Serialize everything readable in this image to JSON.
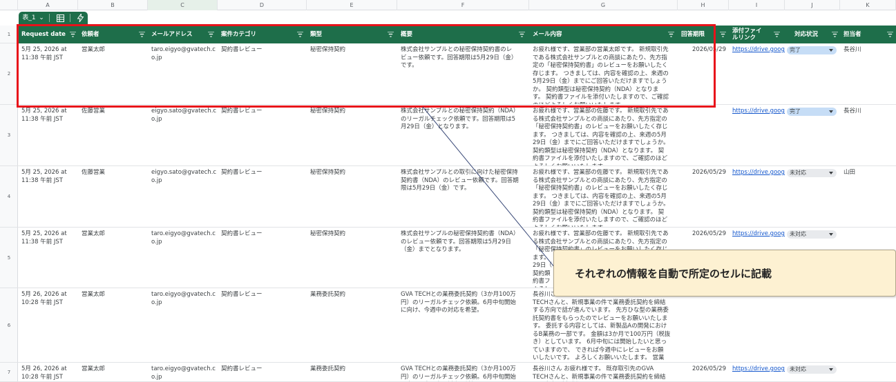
{
  "column_letters": [
    "A",
    "B",
    "C",
    "D",
    "E",
    "F",
    "G",
    "H",
    "I",
    "J",
    "K"
  ],
  "row_numbers": [
    "1",
    "2",
    "3",
    "4",
    "5",
    "6",
    "7"
  ],
  "table_chip": {
    "name": "表_1",
    "chevron": "⌄"
  },
  "colors": {
    "header_bg": "#1e6e4a",
    "highlight": "#e8121a",
    "status_done": "#c6ddf6",
    "status_todo": "#e8eaed",
    "callout_bg": "#fdf1d2",
    "link": "#1155cc"
  },
  "headers": [
    "Request date",
    "依頼者",
    "メールアドレス",
    "案件カテゴリ",
    "類型",
    "概要",
    "メール内容",
    "回答期限",
    "添付ファイ\nルリンク",
    "対応状況",
    "担当者"
  ],
  "rows": [
    {
      "date": "5月 25, 2026 at\n11:38 午前 JST",
      "requester": "営業太郎",
      "email": "taro.eigyo@gvatech.c\no.jp",
      "category": "契約書レビュー",
      "type": "秘密保持契約",
      "summary": "株式会社サンプルとの秘密保持契約書のレ\nビュー依頼です。回答期限は5月29日（金）\nです。",
      "mail": "お疲れ様です、営業部の営業太郎です。 新規取引先\nである株式会社サンプルとの商談にあたり、先方指\n定の「秘密保持契約書」のレビューをお願いしたく\n存じます。 つきましては、内容を確認の上、来週の\n5月29日（金）までにご回答いただけますでしょう\nか。 契約類型は秘密保持契約（NDA）となりま\nす。 契約書ファイルを添付いたしますので、ご確認\nのほどよろしくお願いいたします。",
      "deadline": "2026/05/29",
      "attachment": "https://drive.google",
      "status": "完了",
      "assignee": "長谷川"
    },
    {
      "date": "5月 25, 2026 at\n11:38 午前 JST",
      "requester": "佐藤営業",
      "email": "eigyo.sato@gvatech.c\no.jp",
      "category": "契約書レビュー",
      "type": "秘密保持契約",
      "summary": "株式会社サンプルとの秘密保持契約（NDA）\nのリーガルチェック依頼です。回答期限は5\n月29日（金）となります。",
      "mail": "お疲れ様です、営業部の佐藤です。 新規取引先であ\nる株式会社サンプルとの商談にあたり、先方指定の\n「秘密保持契約書」のレビューをお願いしたく存じ\nます。 つきましては、内容を確認の上、来週の5月\n29日（金）までにご回答いただけますでしょうか。\n契約類型は秘密保持契約（NDA）となります。 契\n約書ファイルを添付いたしますので、ご確認のほど\nよろしくお願いいたします。",
      "deadline": "",
      "attachment": "https://drive.google",
      "status": "完了",
      "assignee": "長谷川"
    },
    {
      "date": "5月 25, 2026 at\n11:38 午前 JST",
      "requester": "佐藤営業",
      "email": "eigyo.sato@gvatech.c\no.jp",
      "category": "契約書レビュー",
      "type": "秘密保持契約",
      "summary": "株式会社サンプルとの取引に向けた秘密保持\n契約書（NDA）のレビュー依頼です。回答期\n限は5月29日（金）です。",
      "mail": "お疲れ様です、営業部の佐藤です。 新規取引先であ\nる株式会社サンプルとの商談にあたり、先方指定の\n「秘密保持契約書」のレビューをお願いしたく存じ\nます。 つきましては、内容を確認の上、来週の5月\n29日（金）までにご回答いただけますでしょうか。\n契約類型は秘密保持契約（NDA）となります。 契\n約書ファイルを添付いたしますので、ご確認のほど\nよろしくお願いいたします。",
      "deadline": "2026/05/29",
      "attachment": "https://drive.google",
      "status": "未対応",
      "assignee": "山田"
    },
    {
      "date": "5月 25, 2026 at\n11:38 午前 JST",
      "requester": "営業太郎",
      "email": "taro.eigyo@gvatech.c\no.jp",
      "category": "契約書レビュー",
      "type": "秘密保持契約",
      "summary": "株式会社サンプルの秘密保持契約書（NDA）\nのレビュー依頼です。回答期限は5月29日\n（金）までとなります。",
      "mail": "お疲れ様です、営業部の佐藤です。 新規取引先であ\nる株式会社サンプルとの商談にあたり、先方指定の\n「秘密保持契約書」のレビューをお願いしたく存じ\nます。\n29日（\n契約類\n約書フ\nよろし",
      "deadline": "2026/05/29",
      "attachment": "https://drive.google",
      "status": "未対応",
      "assignee": ""
    },
    {
      "date": "5月 26, 2026 at\n10:28 午前 JST",
      "requester": "営業太郎",
      "email": "taro.eigyo@gvatech.c\no.jp",
      "category": "契約書レビュー",
      "type": "業務委託契約",
      "summary": "GVA TECHとの業務委託契約（3か月100万\n円）のリーガルチェック依頼。6月中旬開始\nに向け、今週中の対応を希望。",
      "mail": "長谷川さ\nTECHさんと、新規事業の件で業務委託契約を締結\nする方向で話が進んでいます。 先方ひな型の業務委\n託契約書をもらったのでレビューをお願いいたしま\nす。 委託する内容としては、新製品Aの開発におけ\nるB業務の一部です。 金額は3か月で100万円（税抜\nき）としています。 6月中旬には開始したいと思っ\nていますので、 できれば今週中にレビューをお願\nいしたいです。 よろしくお願いいたします。 営業\n太郎",
      "deadline": "",
      "attachment": "",
      "status": "",
      "assignee": ""
    },
    {
      "date": "5月 26, 2026 at\n10:28 午前 JST",
      "requester": "営業太郎",
      "email": "taro.eigyo@gvatech.c\no.jp",
      "category": "契約書レビュー",
      "type": "業務委託契約",
      "summary": "GVA TECHとの業務委託契約（3か月100万\n円）のリーガルチェック依頼。6月中旬開始\nに向け、今週中の対応を希望。",
      "mail": "長谷川さん お疲れ様です。 既存取引先のGVA\nTECHさんと、新規事業の件で業務委託契約を締結\nする方向で話が進んでいます。",
      "deadline": "2026/05/29",
      "attachment": "https://drive.google",
      "status": "未対応",
      "assignee": ""
    }
  ],
  "callout_text": "それぞれの情報を自動で所定のセルに記載"
}
